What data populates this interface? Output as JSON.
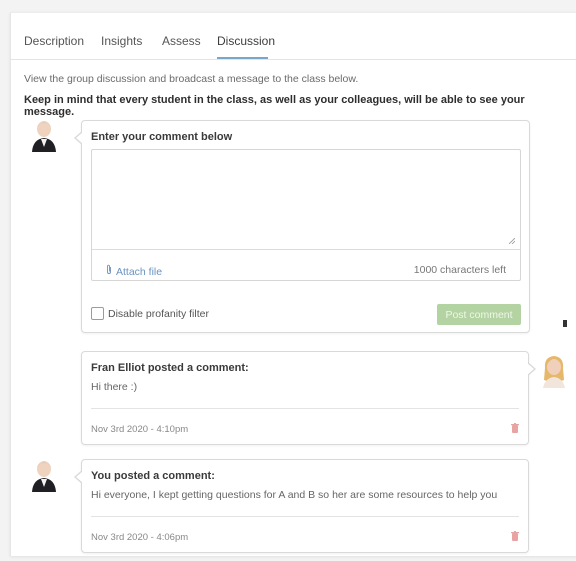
{
  "tabs": [
    {
      "label": "Description"
    },
    {
      "label": "Insights"
    },
    {
      "label": "Assess"
    },
    {
      "label": "Discussion",
      "active": true
    }
  ],
  "intro_text": "View the group discussion and broadcast a message to the class below.",
  "warning_text": "Keep in mind that every student in the class, as well as your colleagues, will be able to see your message.",
  "composer": {
    "title": "Enter your comment below",
    "textarea_value": "",
    "attach_label": "Attach file",
    "chars_left": "1000 characters left",
    "profanity_label": "Disable profanity filter",
    "post_label": "Post comment"
  },
  "comments": [
    {
      "header": "Fran Elliot posted a comment:",
      "body": "Hi there :)",
      "date": "Nov 3rd 2020 - 4:10pm"
    },
    {
      "header": "You posted a comment:",
      "body": "Hi everyone, I kept getting questions for A and B so her are some resources to help you",
      "date": "Nov 3rd 2020 - 4:06pm"
    }
  ],
  "colors": {
    "accent_link": "#6b93c0",
    "post_button": "#b4d3a2",
    "tab_underline": "#7aa7c7",
    "trash": "#e8a3a3"
  },
  "icons": {
    "attach": "paperclip-icon",
    "delete": "trash-icon",
    "avatar": "user-avatar"
  }
}
